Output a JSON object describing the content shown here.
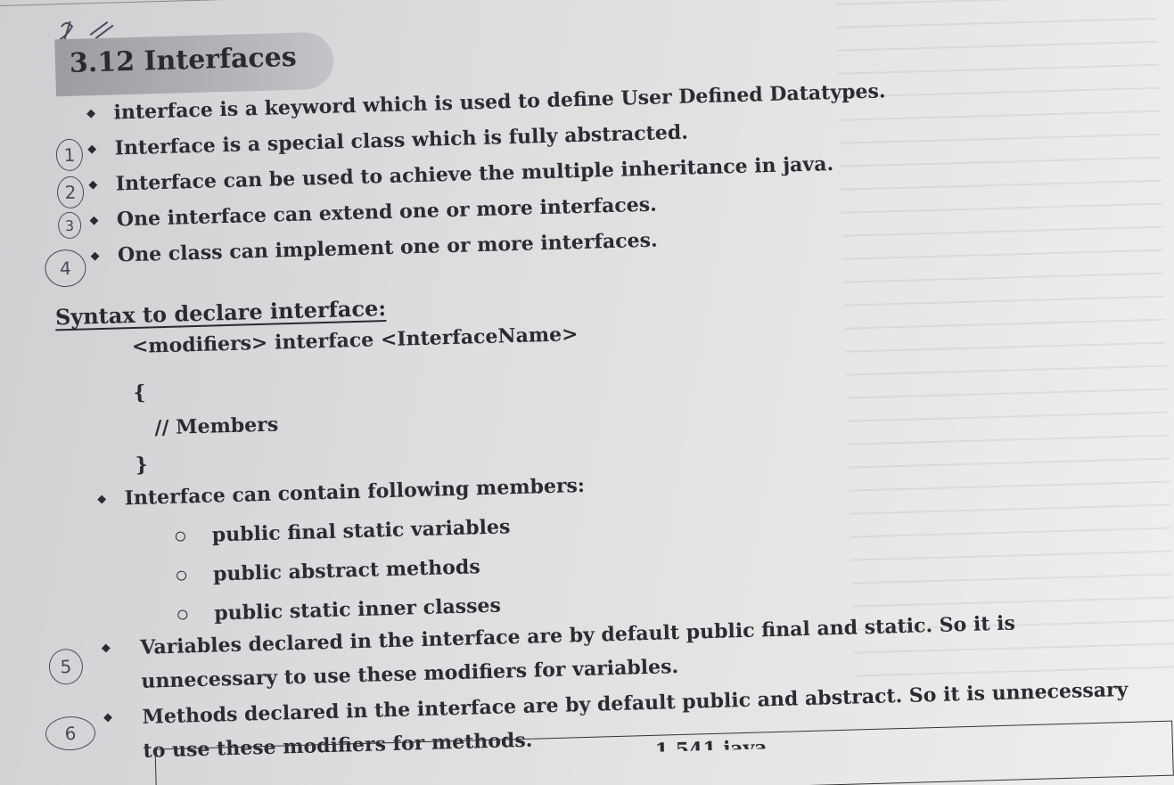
{
  "heading": "3.12 Interfaces",
  "bullets": [
    "interface is a keyword which is used to define User Defined Datatypes.",
    "Interface is a special class which is fully abstracted.",
    "Interface can be used to achieve the multiple inheritance in java.",
    "One interface can extend one or more interfaces.",
    "One class can implement one or more interfaces."
  ],
  "hand_numbers": [
    "1",
    "2",
    "3",
    "4",
    "5",
    "6"
  ],
  "syntax": {
    "title": "Syntax to declare interface:",
    "line1": "<modifiers> interface <InterfaceName>",
    "open_brace": "{",
    "members_comment": "// Members",
    "close_brace": "}"
  },
  "members_intro": "Interface can contain following members:",
  "members": [
    "public final static variables",
    "public abstract methods",
    "public static inner classes"
  ],
  "paragraphs": [
    "Variables declared in the interface are by default public final and static. So it is unnecessary to use these modifiers for variables.",
    "Methods declared in the interface are by default public and abstract. So it is unnecessary to use these modifiers for methods."
  ],
  "footer_partial": "1.541 java"
}
